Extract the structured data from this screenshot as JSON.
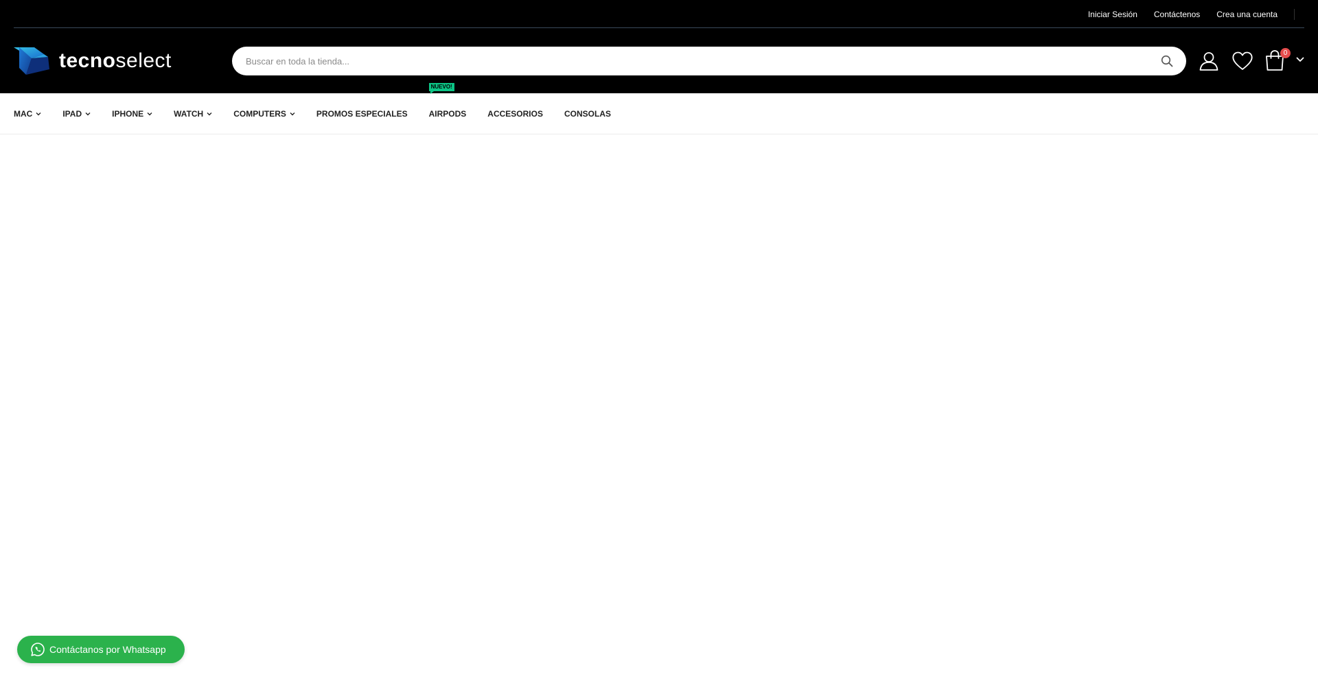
{
  "colors": {
    "header_bg": "#000000",
    "accent_badge": "#0cc485",
    "cart_badge": "#e64c4c",
    "whatsapp": "#2bb24c"
  },
  "top_links": [
    {
      "label": "Iniciar Sesión"
    },
    {
      "label": "Contáctenos"
    },
    {
      "label": "Crea una cuenta"
    }
  ],
  "logo": {
    "part1": "tecno",
    "part2": "select"
  },
  "search": {
    "placeholder": "Buscar en toda la tienda...",
    "value": "",
    "icon": "search-icon"
  },
  "header_icons": {
    "account": "user-icon",
    "wishlist": "heart-icon",
    "cart": "shopping-bag-icon"
  },
  "cart": {
    "count": "0"
  },
  "nav": {
    "items": [
      {
        "label": "MAC",
        "dropdown": true
      },
      {
        "label": "IPAD",
        "dropdown": true
      },
      {
        "label": "IPHONE",
        "dropdown": true
      },
      {
        "label": "WATCH",
        "dropdown": true
      },
      {
        "label": "COMPUTERS",
        "dropdown": true
      },
      {
        "label": "PROMOS ESPECIALES",
        "dropdown": false
      },
      {
        "label": "AIRPODS",
        "dropdown": false,
        "badge": "NUEVO!"
      },
      {
        "label": "ACCESORIOS",
        "dropdown": false
      },
      {
        "label": "CONSOLAS",
        "dropdown": false
      }
    ]
  },
  "whatsapp": {
    "label": "Contáctanos por Whatsapp",
    "icon": "whatsapp-icon"
  }
}
